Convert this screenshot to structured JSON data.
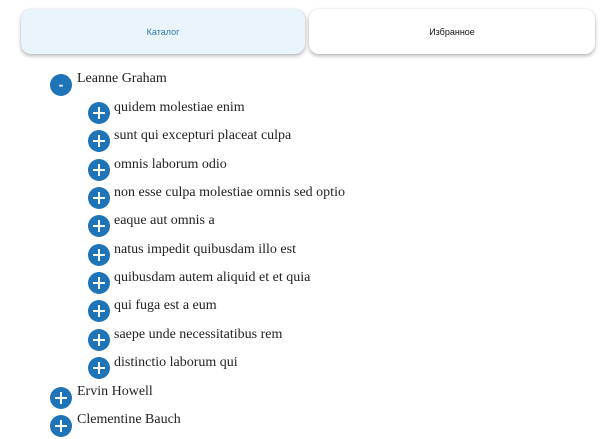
{
  "tabs": {
    "catalog_label": "Каталог",
    "favorites_label": "Избранное",
    "active": "catalog"
  },
  "colors": {
    "toggle_bg": "#1f74b8",
    "active_tab_bg": "#eaf4fb",
    "active_tab_text": "#2e77b0"
  },
  "tree": {
    "users": [
      {
        "name": "Leanne Graham",
        "expanded": true,
        "toggle_icon": "minus-icon",
        "posts": [
          {
            "title": "quidem molestiae enim",
            "toggle_icon": "plus-icon"
          },
          {
            "title": "sunt qui excepturi placeat culpa",
            "toggle_icon": "plus-icon"
          },
          {
            "title": "omnis laborum odio",
            "toggle_icon": "plus-icon"
          },
          {
            "title": "non esse culpa molestiae omnis sed optio",
            "toggle_icon": "plus-icon"
          },
          {
            "title": "eaque aut omnis a",
            "toggle_icon": "plus-icon"
          },
          {
            "title": "natus impedit quibusdam illo est",
            "toggle_icon": "plus-icon"
          },
          {
            "title": "quibusdam autem aliquid et et quia",
            "toggle_icon": "plus-icon"
          },
          {
            "title": "qui fuga est a eum",
            "toggle_icon": "plus-icon"
          },
          {
            "title": "saepe unde necessitatibus rem",
            "toggle_icon": "plus-icon"
          },
          {
            "title": "distinctio laborum qui",
            "toggle_icon": "plus-icon"
          }
        ]
      },
      {
        "name": "Ervin Howell",
        "expanded": false,
        "toggle_icon": "plus-icon",
        "posts": []
      },
      {
        "name": "Clementine Bauch",
        "expanded": false,
        "toggle_icon": "plus-icon",
        "posts": []
      }
    ]
  }
}
